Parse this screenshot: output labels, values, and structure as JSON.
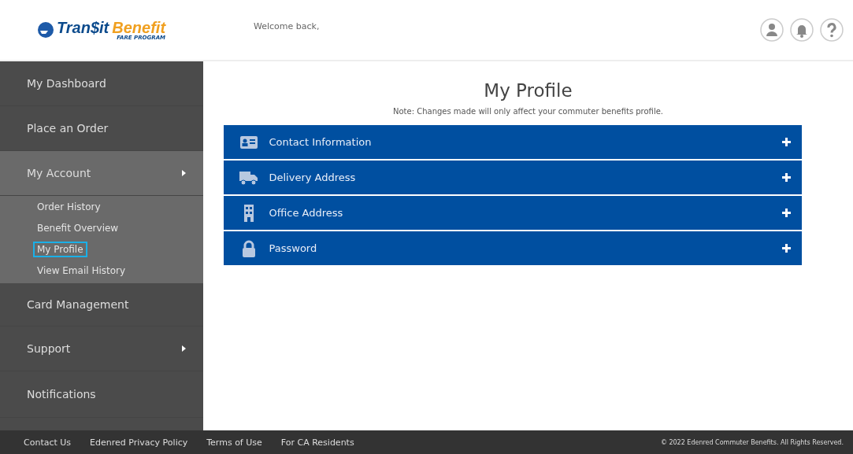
{
  "logo": {
    "primary": "Tran$it",
    "secondary": "Benefit",
    "tagline": "FARE PROGRAM"
  },
  "header": {
    "greeting": "Welcome back,"
  },
  "sidebar": {
    "items": [
      {
        "label": "My Dashboard",
        "expandable": false,
        "expanded": false
      },
      {
        "label": "Place an Order",
        "expandable": false,
        "expanded": false
      },
      {
        "label": "My Account",
        "expandable": true,
        "expanded": true,
        "children": [
          {
            "label": "Order History",
            "selected": false
          },
          {
            "label": "Benefit Overview",
            "selected": false
          },
          {
            "label": "My Profile",
            "selected": true
          },
          {
            "label": "View Email History",
            "selected": false
          }
        ]
      },
      {
        "label": "Card Management",
        "expandable": false,
        "expanded": false
      },
      {
        "label": "Support",
        "expandable": true,
        "expanded": false
      },
      {
        "label": "Notifications",
        "expandable": false,
        "expanded": false
      }
    ]
  },
  "page": {
    "title": "My Profile",
    "note": "Note: Changes made will only affect your commuter benefits profile.",
    "sections": [
      {
        "label": "Contact Information",
        "expanded": false
      },
      {
        "label": "Delivery Address",
        "expanded": false
      },
      {
        "label": "Office Address",
        "expanded": false
      },
      {
        "label": "Password",
        "expanded": false
      }
    ]
  },
  "footer": {
    "links": [
      "Contact Us",
      "Edenred Privacy Policy",
      "Terms of Use",
      "For CA Residents"
    ],
    "copyright": "© 2022 Edenred Commuter Benefits. All Rights Reserved."
  }
}
